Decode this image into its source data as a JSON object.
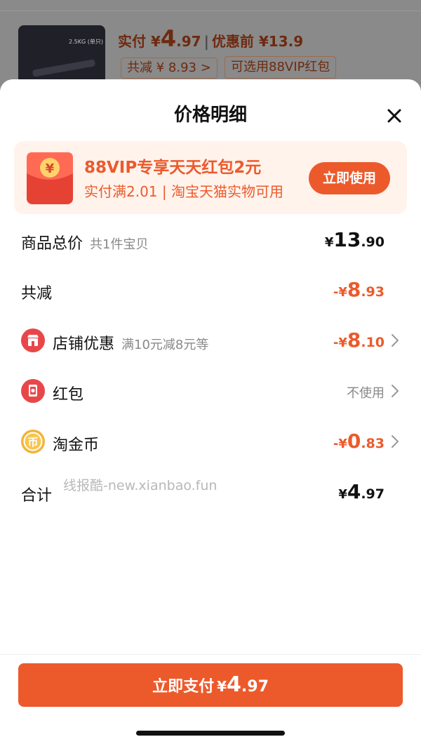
{
  "background": {
    "thumb_label": "2.5KG (单只)",
    "price_label": "实付 ¥",
    "price_int": "4",
    "price_dec": ".97",
    "separator": "|",
    "before_label": "优惠前 ¥13.9",
    "discount_tag": "共减 ¥ 8.93 >",
    "vip_tag": "可选用88VIP红包"
  },
  "sheet": {
    "title": "价格明细"
  },
  "promo": {
    "icon_glyph": "¥",
    "title": "88VIP专享天天红包2元",
    "subtitle": "实付满2.01 | 淘宝天猫实物可用",
    "button": "立即使用"
  },
  "rows": {
    "total_goods": {
      "label": "商品总价",
      "sub": "共1件宝贝",
      "sym": "¥",
      "int": "13",
      "dec": ".90"
    },
    "discount": {
      "label": "共减",
      "sym": "-¥",
      "int": "8",
      "dec": ".93"
    },
    "shop": {
      "label": "店铺优惠",
      "sub": "满10元减8元等",
      "sym": "-¥",
      "int": "8",
      "dec": ".10"
    },
    "redpacket": {
      "label": "红包",
      "value": "不使用"
    },
    "coins": {
      "label": "淘金币",
      "icon_glyph": "币",
      "sym": "-¥",
      "int": "0",
      "dec": ".83"
    },
    "sum": {
      "label": "合计",
      "sym": "¥",
      "int": "4",
      "dec": ".97"
    }
  },
  "watermark": "线报酷-new.xianbao.fun",
  "pay": {
    "label": "立即支付",
    "sym": "¥",
    "int": "4",
    "dec": ".97"
  },
  "colors": {
    "accent": "#ec5a2c",
    "promo_bg": "#fff3ec",
    "shop_icon": "#e8474a",
    "coin_icon": "#f3b43a"
  }
}
